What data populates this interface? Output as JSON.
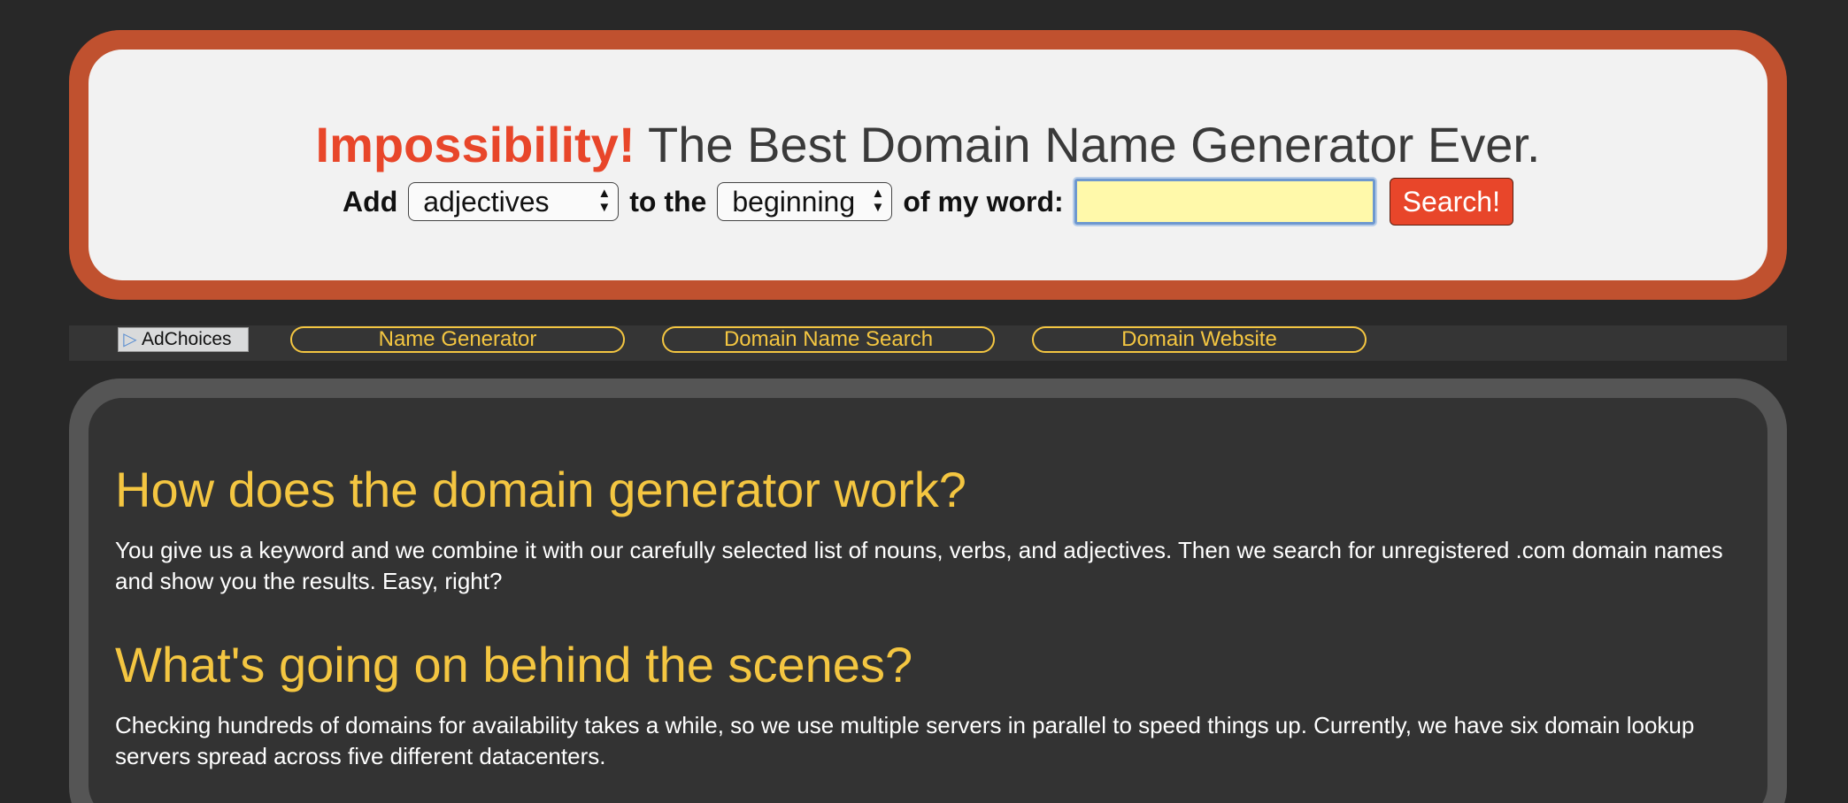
{
  "header": {
    "title_brand": "Impossibility!",
    "title_rest": " The Best Domain Name Generator Ever."
  },
  "form": {
    "add_label": "Add",
    "type_select_value": "adjectives",
    "to_the_label": "to the",
    "position_select_value": "beginning",
    "of_my_word_label": "of my word:",
    "keyword_value": "",
    "search_label": "Search!"
  },
  "nav": {
    "adchoices_label": "AdChoices",
    "links": [
      {
        "label": "Name Generator"
      },
      {
        "label": "Domain Name Search"
      },
      {
        "label": "Domain Website"
      }
    ]
  },
  "content": {
    "sections": [
      {
        "heading": "How does the domain generator work?",
        "text": "You give us a keyword and we combine it with our carefully selected list of nouns, verbs, and adjectives. Then we search for unregistered .com domain names and show you the results. Easy, right?"
      },
      {
        "heading": "What's going on behind the scenes?",
        "text": "Checking hundreds of domains for availability takes a while, so we use multiple servers in parallel to speed things up. Currently, we have six domain lookup servers spread across five different datacenters."
      }
    ]
  },
  "colors": {
    "background": "#282828",
    "header_border": "#c0512f",
    "brand_red": "#e8462a",
    "accent_yellow": "#f4c641",
    "input_yellow": "#fff9aa"
  },
  "icons": {
    "select_arrows": "updown-arrows-icon",
    "adchoices": "adchoices-triangle-icon"
  }
}
